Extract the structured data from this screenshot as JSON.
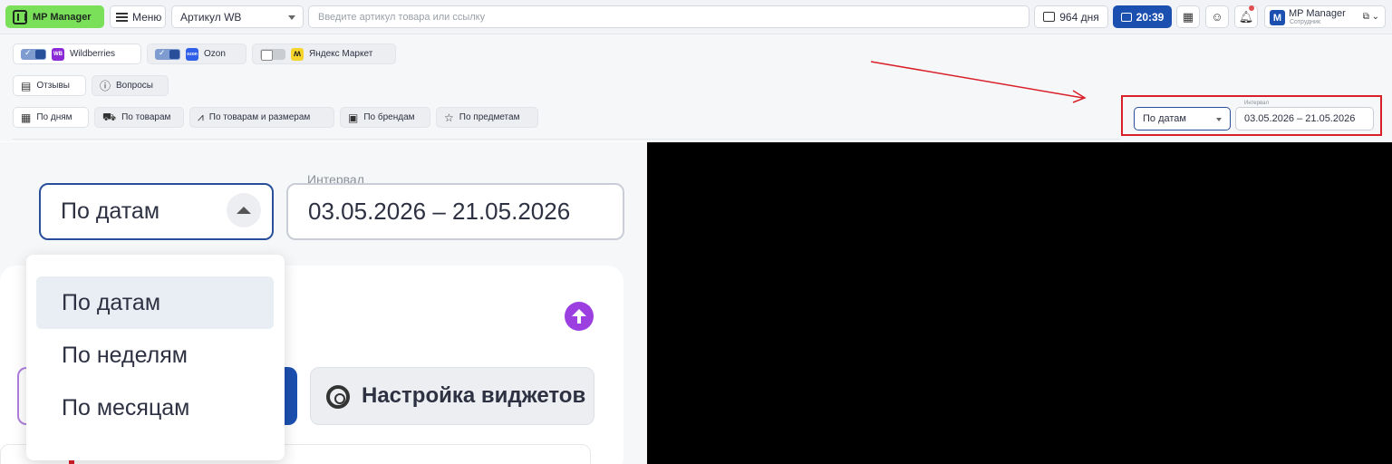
{
  "header": {
    "logo_text": "MP Manager",
    "menu_label": "Меню",
    "article_select": "Артикул WB",
    "search_placeholder": "Введите артикул товара или ссылку",
    "days_label": "964 дня",
    "timer_label": "20:39",
    "user": {
      "avatar_letter": "M",
      "name": "MP Manager",
      "role": "Сотрудник"
    }
  },
  "marketplaces": [
    {
      "label": "Wildberries",
      "badge": "WB",
      "color": "#8b2bd6",
      "enabled": true
    },
    {
      "label": "Ozon",
      "badge": "ozon",
      "color": "#2f5fe8",
      "enabled": true
    },
    {
      "label": "Яндекс Маркет",
      "badge": "",
      "color": "#f5d42b",
      "enabled": false
    }
  ],
  "sections": [
    {
      "label": "Отзывы",
      "icon": "chat-icon"
    },
    {
      "label": "Вопросы",
      "icon": "question-icon"
    }
  ],
  "views": [
    {
      "label": "По дням",
      "icon": "calendar-icon"
    },
    {
      "label": "По товарам",
      "icon": "cart-icon"
    },
    {
      "label": "По товарам и размерам",
      "icon": "chart-icon"
    },
    {
      "label": "По брендам",
      "icon": "tag-icon"
    },
    {
      "label": "По предметам",
      "icon": "star-icon"
    }
  ],
  "period": {
    "selected": "По датам",
    "interval_label": "Интервал",
    "interval_value": "03.05.2026 – 21.05.2026",
    "options": [
      "По датам",
      "По неделям",
      "По месяцам"
    ]
  },
  "widgets_label": "Настройка виджетов",
  "colors": {
    "accent": "#1b4fb0",
    "logo": "#7ae05a",
    "highlight": "#d9202a",
    "purple": "#9b3fe0"
  }
}
